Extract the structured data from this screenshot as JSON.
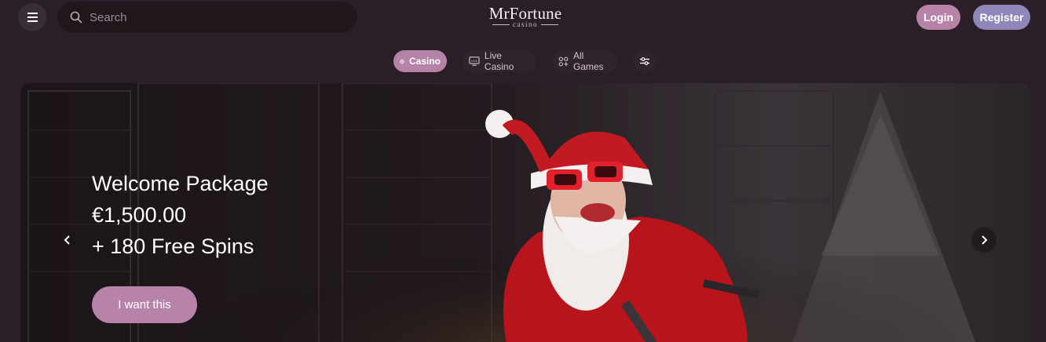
{
  "header": {
    "menu_icon": "hamburger-menu-icon",
    "search": {
      "placeholder": "Search",
      "icon": "search-icon"
    },
    "logo": {
      "text": "MrFortune",
      "sub": "casino"
    },
    "login_label": "Login",
    "register_label": "Register"
  },
  "tabs": [
    {
      "label": "Casino",
      "icon": "casino-chip-icon",
      "active": true
    },
    {
      "label": "Live Casino",
      "icon": "live-tv-icon",
      "active": false
    },
    {
      "label": "All Games",
      "icon": "grid-icon",
      "active": false
    },
    {
      "label": "",
      "icon": "filter-sliders-icon",
      "active": false
    }
  ],
  "hero": {
    "line1": "Welcome Package",
    "line2": "€1,500.00",
    "line3": "+ 180 Free Spins",
    "cta_label": "I want this",
    "prev_icon": "chevron-left-icon",
    "next_icon": "chevron-right-icon"
  },
  "colors": {
    "background": "#2a1f26",
    "login": "#b883a9",
    "register": "#8f86ba",
    "active_tab": "#b583a8"
  }
}
